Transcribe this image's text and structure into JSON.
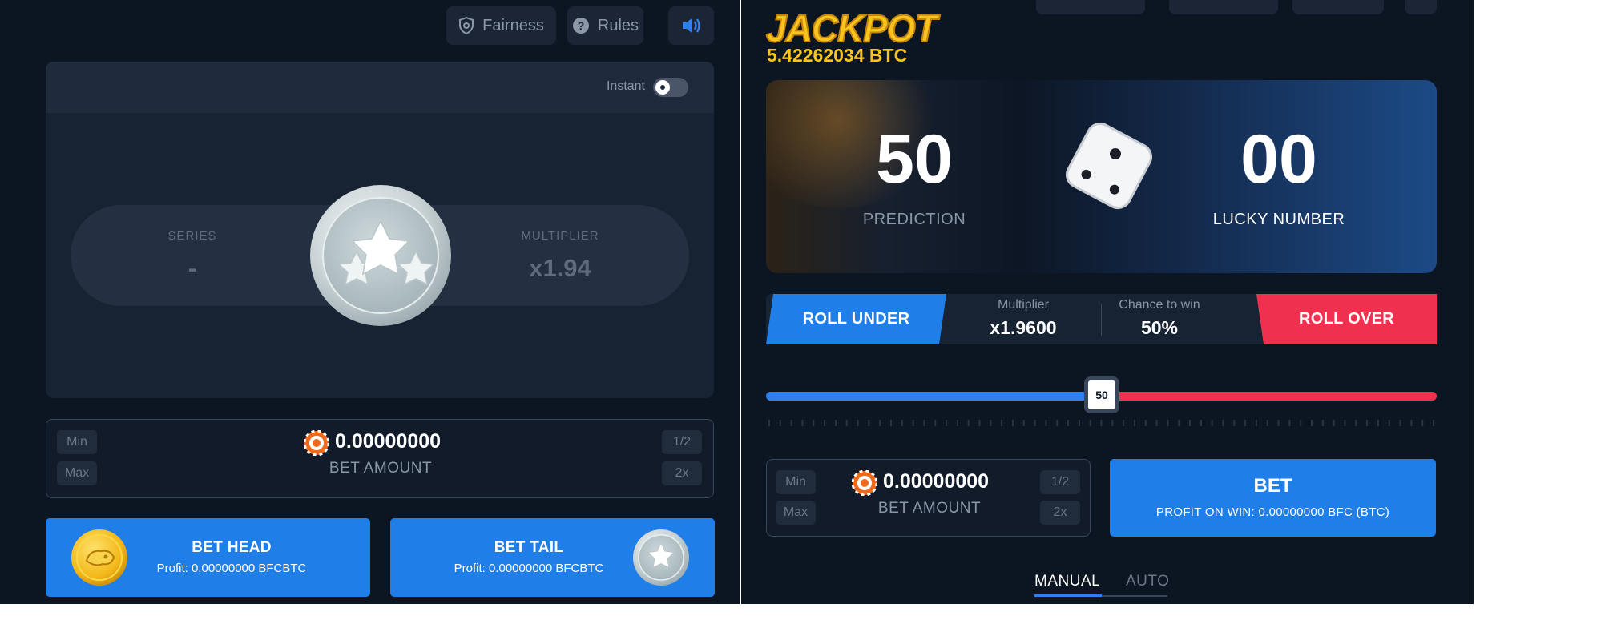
{
  "left": {
    "top_buttons": {
      "fairness": "Fairness",
      "rules": "Rules",
      "sound_icon": "speaker-icon"
    },
    "game": {
      "instant_label": "Instant",
      "series_label": "SERIES",
      "series_value": "-",
      "multiplier_label": "MULTIPLIER",
      "multiplier_value": "x1.94"
    },
    "bet": {
      "min": "Min",
      "max": "Max",
      "half": "1/2",
      "double": "2x",
      "amount": "0.00000000",
      "amount_label": "BET AMOUNT"
    },
    "bet_head": {
      "title": "BET HEAD",
      "profit_label": "Profit:",
      "profit_value": "0.00000000 BFCBTC"
    },
    "bet_tail": {
      "title": "BET TAIL",
      "profit_label": "Profit:",
      "profit_value": "0.00000000 BFCBTC"
    }
  },
  "right": {
    "jackpot": {
      "title": "JACKPOT",
      "amount": "5.42262034 BTC"
    },
    "hero": {
      "prediction_value": "50",
      "prediction_label": "PREDICTION",
      "lucky_value": "00",
      "lucky_label": "LUCKY NUMBER"
    },
    "roll": {
      "under_label": "ROLL UNDER",
      "over_label": "ROLL OVER",
      "multiplier_label": "Multiplier",
      "multiplier_value": "x1.9600",
      "chance_label": "Chance to win",
      "chance_value": "50%"
    },
    "slider": {
      "value": 50,
      "min": 0,
      "max": 100,
      "label": "50"
    },
    "bet": {
      "min": "Min",
      "max": "Max",
      "half": "1/2",
      "double": "2x",
      "amount": "0.00000000",
      "amount_label": "BET AMOUNT"
    },
    "bet_button": {
      "title": "BET",
      "profit": "PROFIT ON WIN: 0.00000000 BFC (BTC)"
    },
    "tabs": {
      "manual": "MANUAL",
      "auto": "AUTO",
      "active": "MANUAL"
    }
  },
  "colors": {
    "background": "#0c1522",
    "accent_blue": "#1f7ee8",
    "accent_red": "#f0304f",
    "jackpot_gold": "#f7c51e"
  }
}
